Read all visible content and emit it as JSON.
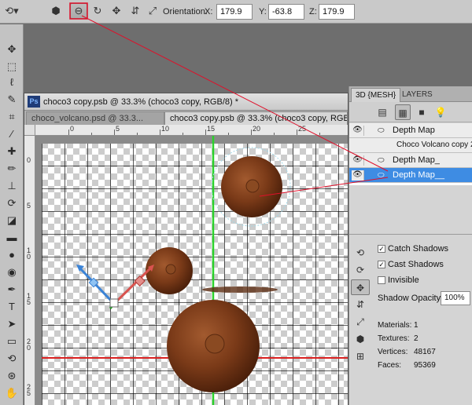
{
  "options_bar": {
    "orientation_label": "Orientation:",
    "x_label": "X:",
    "x_value": "179.9",
    "y_label": "Y:",
    "y_value": "-63.8",
    "z_label": "Z:",
    "z_value": "179.9"
  },
  "document": {
    "title": "choco3 copy.psb @ 33.3% (choco3 copy, RGB/8) *",
    "tabs": [
      {
        "label": "choco_volcano.psd @ 33.3...",
        "active": false
      },
      {
        "label": "choco3 copy.psb @ 33.3% (choco3 copy, RGB/8)",
        "active": true
      }
    ],
    "ruler_top": [
      "0",
      "5",
      "10",
      "15",
      "20",
      "25"
    ],
    "ruler_left": [
      "0",
      "5",
      "1 0",
      "1 5",
      "2 0",
      "2 5"
    ]
  },
  "panel": {
    "tabs": [
      "3D {MESH}",
      "LAYERS"
    ],
    "meshes": [
      {
        "label": "Depth Map",
        "selected": false,
        "indent": false
      },
      {
        "label": "Choco Volcano copy 2",
        "selected": false,
        "indent": true
      },
      {
        "label": "Depth Map_",
        "selected": false,
        "indent": false
      },
      {
        "label": "Depth Map__",
        "selected": true,
        "indent": false
      }
    ],
    "catch_shadows": "Catch Shadows",
    "cast_shadows": "Cast Shadows",
    "invisible": "Invisible",
    "shadow_opacity_label": "Shadow Opacity:",
    "shadow_opacity_value": "100%",
    "stats": [
      {
        "label": "Materials:",
        "value": "1"
      },
      {
        "label": "Textures:",
        "value": "2"
      },
      {
        "label": "Vertices:",
        "value": "48167"
      },
      {
        "label": "Faces:",
        "value": "95369"
      }
    ]
  },
  "colors": {
    "selection": "#3e8ce3",
    "guide_green": "#2bd12b",
    "guide_red": "#d92020",
    "annotation": "#e0102a"
  }
}
